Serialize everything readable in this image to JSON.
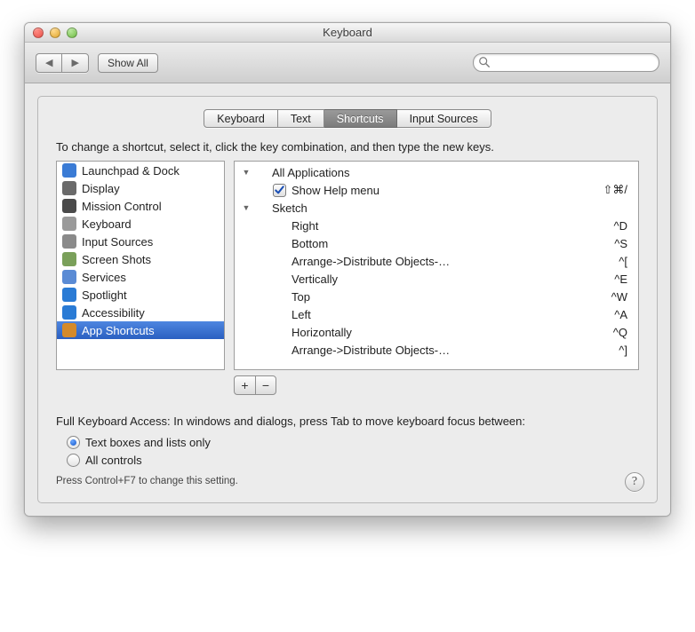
{
  "window": {
    "title": "Keyboard"
  },
  "toolbar": {
    "back_tooltip": "Back",
    "forward_tooltip": "Forward",
    "show_all": "Show All",
    "search_placeholder": ""
  },
  "tabs": {
    "items": [
      "Keyboard",
      "Text",
      "Shortcuts",
      "Input Sources"
    ],
    "active_index": 2
  },
  "instructions": "To change a shortcut, select it, click the key combination, and then type the new keys.",
  "categories": [
    {
      "label": "Launchpad & Dock",
      "icon": "launchpad-icon",
      "color": "#3a7bd5"
    },
    {
      "label": "Display",
      "icon": "display-icon",
      "color": "#6a6a6a"
    },
    {
      "label": "Mission Control",
      "icon": "mission-control-icon",
      "color": "#4a4a4a"
    },
    {
      "label": "Keyboard",
      "icon": "keyboard-icon",
      "color": "#9a9a9a"
    },
    {
      "label": "Input Sources",
      "icon": "input-sources-icon",
      "color": "#8a8a8a"
    },
    {
      "label": "Screen Shots",
      "icon": "screen-shots-icon",
      "color": "#7aa05a"
    },
    {
      "label": "Services",
      "icon": "services-icon",
      "color": "#5a8bd5"
    },
    {
      "label": "Spotlight",
      "icon": "spotlight-icon",
      "color": "#2a7bd5"
    },
    {
      "label": "Accessibility",
      "icon": "accessibility-icon",
      "color": "#2a7bd5"
    },
    {
      "label": "App Shortcuts",
      "icon": "app-shortcuts-icon",
      "color": "#d58a2a",
      "selected": true
    }
  ],
  "shortcut_tree": [
    {
      "type": "group",
      "indent": 0,
      "expanded": true,
      "label": "All Applications"
    },
    {
      "type": "item",
      "indent": 1,
      "checked": true,
      "label": "Show Help menu",
      "key": "⇧⌘/"
    },
    {
      "type": "group",
      "indent": 0,
      "expanded": true,
      "label": "Sketch"
    },
    {
      "type": "item",
      "indent": 1,
      "label": "Right",
      "key": "^D"
    },
    {
      "type": "item",
      "indent": 1,
      "label": "Bottom",
      "key": "^S"
    },
    {
      "type": "item",
      "indent": 1,
      "label": "Arrange->Distribute Objects-…",
      "key": "^["
    },
    {
      "type": "item",
      "indent": 1,
      "label": "Vertically",
      "key": "^E"
    },
    {
      "type": "item",
      "indent": 1,
      "label": "Top",
      "key": "^W"
    },
    {
      "type": "item",
      "indent": 1,
      "label": "Left",
      "key": "^A"
    },
    {
      "type": "item",
      "indent": 1,
      "label": "Horizontally",
      "key": "^Q"
    },
    {
      "type": "item",
      "indent": 1,
      "label": "Arrange->Distribute Objects-…",
      "key": "^]"
    }
  ],
  "add_remove": {
    "add": "+",
    "remove": "−"
  },
  "fka": {
    "label": "Full Keyboard Access: In windows and dialogs, press Tab to move keyboard focus between:",
    "options": [
      "Text boxes and lists only",
      "All controls"
    ],
    "selected_index": 0,
    "hint": "Press Control+F7 to change this setting."
  },
  "help_tooltip": "Help"
}
